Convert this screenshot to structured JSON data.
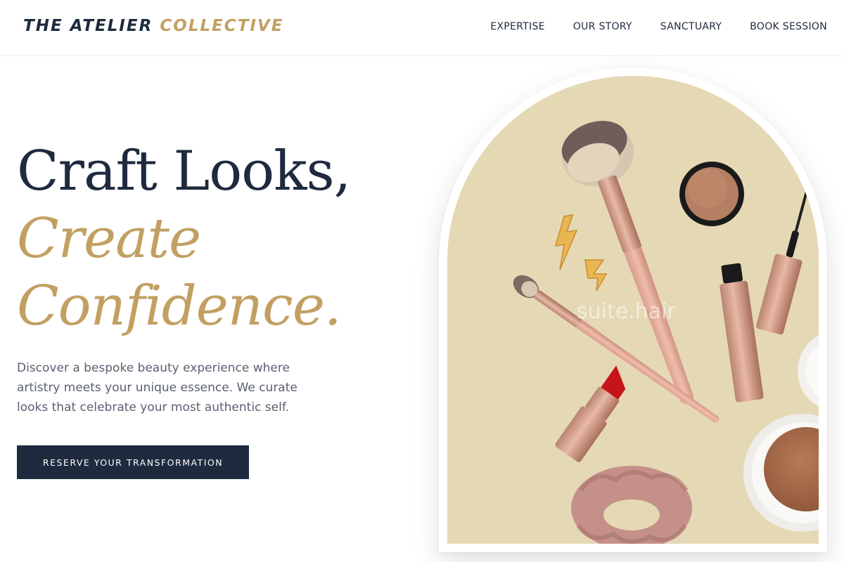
{
  "brand": {
    "name_primary": "THE ATELIER",
    "name_accent": "COLLECTIVE",
    "navy": "#1e2a3e",
    "gold": "#c2a062"
  },
  "nav": {
    "items": [
      {
        "label": "EXPERTISE"
      },
      {
        "label": "OUR STORY"
      },
      {
        "label": "SANCTUARY"
      },
      {
        "label": "BOOK SESSION"
      }
    ]
  },
  "hero": {
    "headline_line1": "Craft Looks,",
    "headline_line2": "Create",
    "headline_line3": "Confidence.",
    "description": "Discover a bespoke beauty experience where artistry meets your unique essence. We curate looks that celebrate your most authentic self.",
    "cta_label": "RESERVE YOUR TRANSFORMATION"
  },
  "hero_image": {
    "watermark": "suite.hair",
    "background_color": "#e5d8b4"
  }
}
